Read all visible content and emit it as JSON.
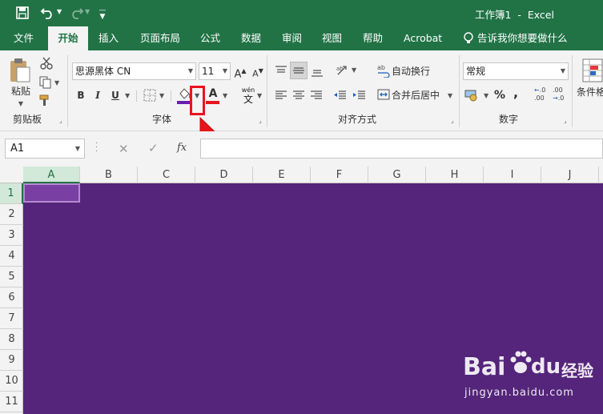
{
  "titlebar": {
    "title": "工作簿1  -  Excel"
  },
  "tabs": [
    {
      "label": "文件"
    },
    {
      "label": "开始",
      "active": true
    },
    {
      "label": "插入"
    },
    {
      "label": "页面布局"
    },
    {
      "label": "公式"
    },
    {
      "label": "数据"
    },
    {
      "label": "审阅"
    },
    {
      "label": "视图"
    },
    {
      "label": "帮助"
    },
    {
      "label": "Acrobat"
    },
    {
      "label": "告诉我你想要做什么"
    }
  ],
  "ribbon": {
    "clipboard": {
      "label": "剪贴板",
      "paste": "粘贴"
    },
    "font": {
      "label": "字体",
      "font_name": "思源黑体 CN",
      "font_size": "11",
      "bold": "B",
      "italic": "I",
      "underline": "U",
      "grow": "A",
      "shrink": "A",
      "font_color_letter": "A",
      "phonetic_top": "wén",
      "phonetic_bottom": "文",
      "fill_color": "#6b1fa8",
      "font_color": "#e8141b"
    },
    "alignment": {
      "label": "对齐方式",
      "wrap_text": "自动换行",
      "merge_center": "合并后居中"
    },
    "number": {
      "label": "数字",
      "format": "常规",
      "percent": "%",
      "comma": ",",
      "inc_decimal": ".00",
      "dec_decimal": ".0"
    },
    "styles": {
      "cond_format": "条件格"
    }
  },
  "formula_bar": {
    "name_box": "A1",
    "fx": "fx"
  },
  "columns": [
    "A",
    "B",
    "C",
    "D",
    "E",
    "F",
    "G",
    "H",
    "I",
    "J"
  ],
  "rows": [
    "1",
    "2",
    "3",
    "4",
    "5",
    "6",
    "7",
    "8",
    "9",
    "10",
    "11"
  ],
  "watermark": {
    "brand": "Bai",
    "brand2": "du",
    "cn": "经验",
    "url": "jingyan.baidu.com"
  },
  "colors": {
    "accent": "#217346",
    "grid_fill": "#54257a",
    "highlight": "#e8141b"
  }
}
